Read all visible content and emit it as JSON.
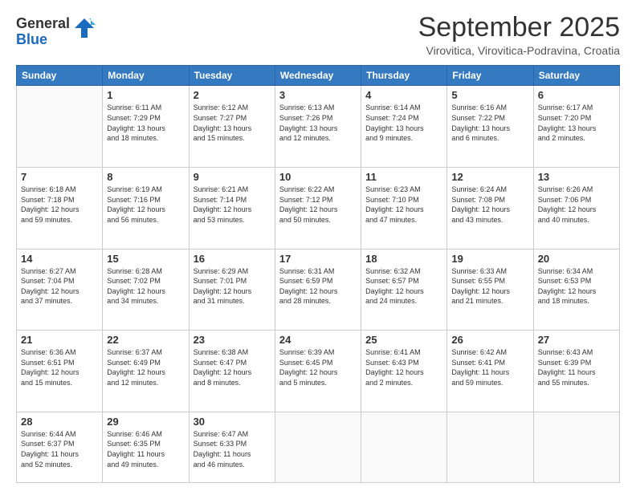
{
  "logo": {
    "general": "General",
    "blue": "Blue"
  },
  "header": {
    "month": "September 2025",
    "location": "Virovitica, Virovitica-Podravina, Croatia"
  },
  "weekdays": [
    "Sunday",
    "Monday",
    "Tuesday",
    "Wednesday",
    "Thursday",
    "Friday",
    "Saturday"
  ],
  "weeks": [
    [
      {
        "day": "",
        "info": ""
      },
      {
        "day": "1",
        "info": "Sunrise: 6:11 AM\nSunset: 7:29 PM\nDaylight: 13 hours\nand 18 minutes."
      },
      {
        "day": "2",
        "info": "Sunrise: 6:12 AM\nSunset: 7:27 PM\nDaylight: 13 hours\nand 15 minutes."
      },
      {
        "day": "3",
        "info": "Sunrise: 6:13 AM\nSunset: 7:26 PM\nDaylight: 13 hours\nand 12 minutes."
      },
      {
        "day": "4",
        "info": "Sunrise: 6:14 AM\nSunset: 7:24 PM\nDaylight: 13 hours\nand 9 minutes."
      },
      {
        "day": "5",
        "info": "Sunrise: 6:16 AM\nSunset: 7:22 PM\nDaylight: 13 hours\nand 6 minutes."
      },
      {
        "day": "6",
        "info": "Sunrise: 6:17 AM\nSunset: 7:20 PM\nDaylight: 13 hours\nand 2 minutes."
      }
    ],
    [
      {
        "day": "7",
        "info": "Sunrise: 6:18 AM\nSunset: 7:18 PM\nDaylight: 12 hours\nand 59 minutes."
      },
      {
        "day": "8",
        "info": "Sunrise: 6:19 AM\nSunset: 7:16 PM\nDaylight: 12 hours\nand 56 minutes."
      },
      {
        "day": "9",
        "info": "Sunrise: 6:21 AM\nSunset: 7:14 PM\nDaylight: 12 hours\nand 53 minutes."
      },
      {
        "day": "10",
        "info": "Sunrise: 6:22 AM\nSunset: 7:12 PM\nDaylight: 12 hours\nand 50 minutes."
      },
      {
        "day": "11",
        "info": "Sunrise: 6:23 AM\nSunset: 7:10 PM\nDaylight: 12 hours\nand 47 minutes."
      },
      {
        "day": "12",
        "info": "Sunrise: 6:24 AM\nSunset: 7:08 PM\nDaylight: 12 hours\nand 43 minutes."
      },
      {
        "day": "13",
        "info": "Sunrise: 6:26 AM\nSunset: 7:06 PM\nDaylight: 12 hours\nand 40 minutes."
      }
    ],
    [
      {
        "day": "14",
        "info": "Sunrise: 6:27 AM\nSunset: 7:04 PM\nDaylight: 12 hours\nand 37 minutes."
      },
      {
        "day": "15",
        "info": "Sunrise: 6:28 AM\nSunset: 7:02 PM\nDaylight: 12 hours\nand 34 minutes."
      },
      {
        "day": "16",
        "info": "Sunrise: 6:29 AM\nSunset: 7:01 PM\nDaylight: 12 hours\nand 31 minutes."
      },
      {
        "day": "17",
        "info": "Sunrise: 6:31 AM\nSunset: 6:59 PM\nDaylight: 12 hours\nand 28 minutes."
      },
      {
        "day": "18",
        "info": "Sunrise: 6:32 AM\nSunset: 6:57 PM\nDaylight: 12 hours\nand 24 minutes."
      },
      {
        "day": "19",
        "info": "Sunrise: 6:33 AM\nSunset: 6:55 PM\nDaylight: 12 hours\nand 21 minutes."
      },
      {
        "day": "20",
        "info": "Sunrise: 6:34 AM\nSunset: 6:53 PM\nDaylight: 12 hours\nand 18 minutes."
      }
    ],
    [
      {
        "day": "21",
        "info": "Sunrise: 6:36 AM\nSunset: 6:51 PM\nDaylight: 12 hours\nand 15 minutes."
      },
      {
        "day": "22",
        "info": "Sunrise: 6:37 AM\nSunset: 6:49 PM\nDaylight: 12 hours\nand 12 minutes."
      },
      {
        "day": "23",
        "info": "Sunrise: 6:38 AM\nSunset: 6:47 PM\nDaylight: 12 hours\nand 8 minutes."
      },
      {
        "day": "24",
        "info": "Sunrise: 6:39 AM\nSunset: 6:45 PM\nDaylight: 12 hours\nand 5 minutes."
      },
      {
        "day": "25",
        "info": "Sunrise: 6:41 AM\nSunset: 6:43 PM\nDaylight: 12 hours\nand 2 minutes."
      },
      {
        "day": "26",
        "info": "Sunrise: 6:42 AM\nSunset: 6:41 PM\nDaylight: 11 hours\nand 59 minutes."
      },
      {
        "day": "27",
        "info": "Sunrise: 6:43 AM\nSunset: 6:39 PM\nDaylight: 11 hours\nand 55 minutes."
      }
    ],
    [
      {
        "day": "28",
        "info": "Sunrise: 6:44 AM\nSunset: 6:37 PM\nDaylight: 11 hours\nand 52 minutes."
      },
      {
        "day": "29",
        "info": "Sunrise: 6:46 AM\nSunset: 6:35 PM\nDaylight: 11 hours\nand 49 minutes."
      },
      {
        "day": "30",
        "info": "Sunrise: 6:47 AM\nSunset: 6:33 PM\nDaylight: 11 hours\nand 46 minutes."
      },
      {
        "day": "",
        "info": ""
      },
      {
        "day": "",
        "info": ""
      },
      {
        "day": "",
        "info": ""
      },
      {
        "day": "",
        "info": ""
      }
    ]
  ]
}
